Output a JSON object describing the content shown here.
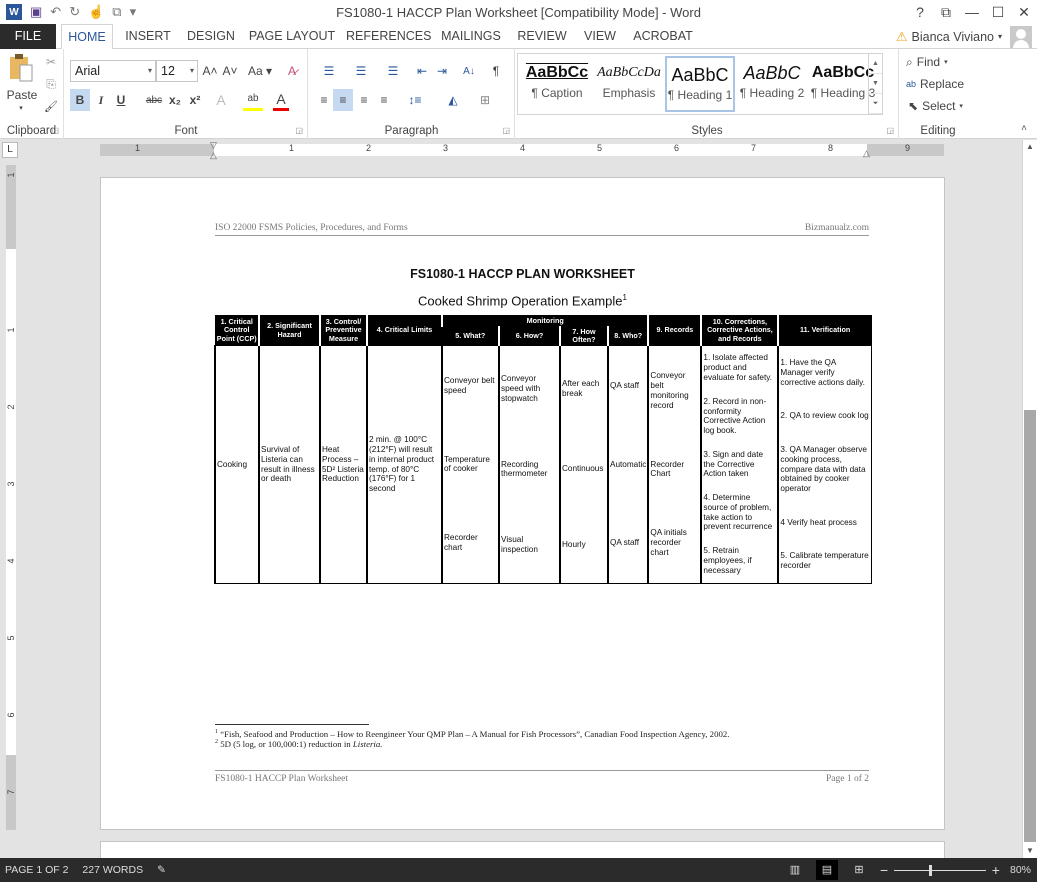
{
  "window": {
    "title": "FS1080-1 HACCP Plan Worksheet [Compatibility Mode] - Word",
    "controls": {
      "help": "?",
      "ribbon_display": "⧉",
      "minimize": "—",
      "maximize": "☐",
      "close": "✕"
    }
  },
  "quick_access": {
    "word_icon": "W",
    "save_icon": "💾",
    "undo_icon": "↶",
    "redo_icon": "↻",
    "touch_icon": "☝",
    "more_icon": "▾"
  },
  "tabs": [
    {
      "label": "FILE"
    },
    {
      "label": "HOME",
      "active": true
    },
    {
      "label": "INSERT"
    },
    {
      "label": "DESIGN"
    },
    {
      "label": "PAGE LAYOUT"
    },
    {
      "label": "REFERENCES"
    },
    {
      "label": "MAILINGS"
    },
    {
      "label": "REVIEW"
    },
    {
      "label": "VIEW"
    },
    {
      "label": "ACROBAT"
    }
  ],
  "user": {
    "name": "Bianca Viviano",
    "warning_icon": "⚠",
    "dropdown": "▾"
  },
  "ribbon": {
    "clipboard": {
      "label": "Clipboard",
      "paste": "Paste",
      "paste_dd": "▾",
      "cut_icon": "✂",
      "copy_icon": "⎘",
      "format_painter_icon": "🖌"
    },
    "font": {
      "label": "Font",
      "font_name": "Arial",
      "font_size": "12",
      "grow": "A˄",
      "shrink": "A˅",
      "change_case": "Aa ▾",
      "clear_format": "A̷",
      "bold": "B",
      "italic": "I",
      "underline": "U",
      "strike": "abc",
      "subscript": "x₂",
      "superscript": "x²",
      "text_effects": "A",
      "highlight": "ab",
      "font_color": "A"
    },
    "paragraph": {
      "label": "Paragraph",
      "bullets": "☰",
      "numbering": "☰",
      "multilevel": "☰",
      "decrease_indent": "⇤",
      "increase_indent": "⇥",
      "sort": "A↓",
      "show_marks": "¶",
      "align_left": "≡",
      "center": "≡",
      "align_right": "≡",
      "justify": "≡",
      "line_spacing": "↕≡",
      "shading": "◭",
      "borders": "⊞"
    },
    "styles": {
      "label": "Styles",
      "items": [
        {
          "preview": "AaBbCc",
          "name": "¶ Caption"
        },
        {
          "preview": "AaBbCcDa",
          "name": "Emphasis"
        },
        {
          "preview": "AaBbC",
          "name": "¶ Heading 1",
          "active": true
        },
        {
          "preview": "AaBbC",
          "name": "¶ Heading 2"
        },
        {
          "preview": "AaBbCc",
          "name": "¶ Heading 3"
        }
      ]
    },
    "editing": {
      "label": "Editing",
      "find": "Find",
      "replace": "Replace",
      "select": "Select"
    }
  },
  "ruler": {
    "horizontal_labels": [
      "1",
      "1",
      "2",
      "3",
      "4",
      "5",
      "6",
      "7",
      "8",
      "9"
    ],
    "vertical_labels": [
      "1",
      "1",
      "2",
      "3",
      "4",
      "5",
      "6",
      "7"
    ],
    "tab_selector": "L"
  },
  "document": {
    "header_left": "ISO 22000 FSMS Policies, Procedures, and Forms",
    "header_right": "Bizmanualz.com",
    "heading": "FS1080-1 HACCP PLAN WORKSHEET",
    "subtitle": "Cooked Shrimp Operation Example",
    "subtitle_sup": "1",
    "table": {
      "monitoring_header": "Monitoring",
      "columns": [
        "1. Critical Control Point (CCP)",
        "2. Significant Hazard",
        "3. Control/ Preventive Measure",
        "4. Critical Limits",
        "5. What?",
        "6. How?",
        "7. How Often?",
        "8. Who?",
        "9. Records",
        "10. Corrections, Corrective Actions, and Records",
        "11. Verification"
      ],
      "row": {
        "ccp": "Cooking",
        "hazard": "Survival of Listeria can result in illness or death",
        "control": "Heat Process – 5D² Listeria Reduction",
        "limits": "2 min. @ 100°C (212°F) will result in internal product temp. of 80°C (176°F) for 1 second",
        "what": [
          "Conveyor belt speed",
          "Temperature of cooker",
          "Recorder chart"
        ],
        "how": [
          "Conveyor speed with stopwatch",
          "Recording thermometer",
          "Visual inspection"
        ],
        "how_often": [
          "After each break",
          "Continuous",
          "Hourly"
        ],
        "who": [
          "QA staff",
          "Automatic",
          "QA staff"
        ],
        "records": [
          "Conveyor belt monitoring record",
          "Recorder Chart",
          "QA initials recorder chart"
        ],
        "corrections": [
          "1. Isolate affected product and evaluate for safety.",
          "2. Record in non-conformity Corrective Action log book.",
          "3. Sign and date the Corrective Action taken",
          "4. Determine source of problem, take action to prevent recurrence",
          "5. Retrain employees, if necessary"
        ],
        "verification": [
          "1. Have the QA Manager verify corrective actions daily.",
          "2. QA to review cook log",
          "3. QA Manager observe cooking process, compare data with data obtained by cooker operator",
          "4 Verify heat process",
          "5. Calibrate temperature recorder"
        ]
      }
    },
    "footnotes": [
      {
        "mark": "1",
        "text": "“Fish, Seafood and Production – How to Reengineer Your QMP Plan – A Manual for Fish Processors”, Canadian Food Inspection Agency, 2002."
      },
      {
        "mark": "2",
        "text": "5D (5 log, or 100,000:1) reduction in ",
        "italic": "Listeria."
      }
    ],
    "footer_left": "FS1080-1 HACCP Plan Worksheet",
    "footer_right": "Page 1 of 2"
  },
  "statusbar": {
    "page": "PAGE 1 OF 2",
    "words": "227 WORDS",
    "proofing_icon": "✎",
    "read_mode_icon": "📖",
    "print_layout_icon": "▤",
    "web_layout_icon": "⊞",
    "zoom_minus": "−",
    "zoom_plus": "+",
    "zoom_level": "80%",
    "zoom_fraction": 0.8
  }
}
